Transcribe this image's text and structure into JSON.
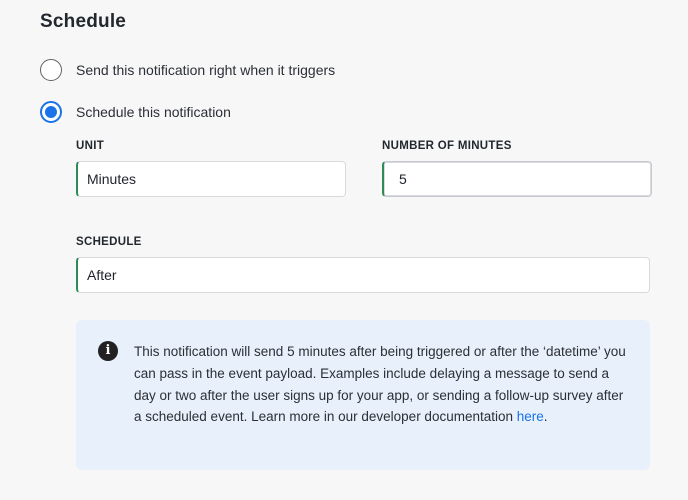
{
  "section": {
    "title": "Schedule"
  },
  "options": [
    {
      "label": "Send this notification right when it triggers",
      "selected": false
    },
    {
      "label": "Schedule this notification",
      "selected": true
    }
  ],
  "unit": {
    "label": "UNIT",
    "value": "Minutes"
  },
  "number_of_minutes": {
    "label": "NUMBER OF MINUTES",
    "value": "5"
  },
  "schedule": {
    "label": "SCHEDULE",
    "value": "After"
  },
  "info": {
    "icon": "info-circle-icon",
    "text": "This notification will send 5 minutes after being triggered or after the ‘datetime’ you can pass in the event payload. Examples include delaying a message to send a day or two after the user signs up for your app, or sending a follow-up survey after a scheduled event. Learn more in our developer documentation ",
    "link_text": "here",
    "after_link": "."
  },
  "colors": {
    "accent": "#1a73e8",
    "input_focus_edge": "#2e8b57",
    "info_bg": "#e8f0fb"
  }
}
